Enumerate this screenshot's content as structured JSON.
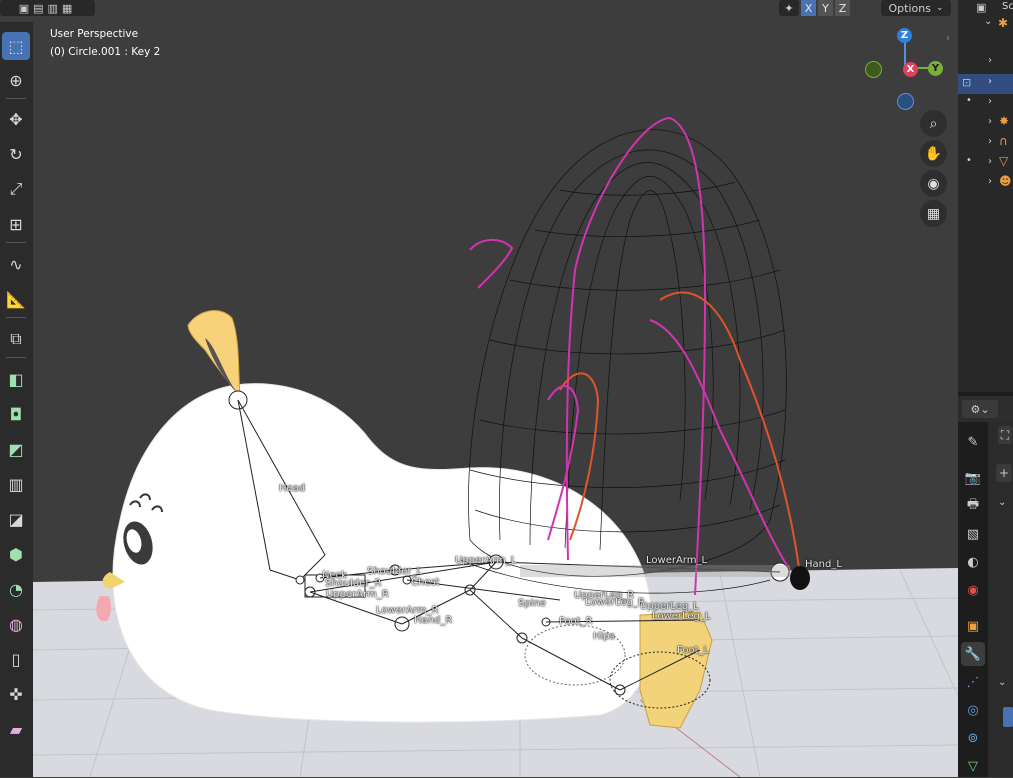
{
  "viewport": {
    "view_name": "User Perspective",
    "object_info": "(0) Circle.001 : Key 2",
    "options_label": "Options",
    "axes": {
      "x": "X",
      "y": "Y",
      "z": "Z"
    },
    "gizmo": {
      "z": "Z",
      "y": "Y",
      "x": "X"
    }
  },
  "bones": {
    "head": "Head",
    "neck": "Neck",
    "shoulder_l": "Shoulder_L",
    "shoulder_r": "Shoulder_R",
    "chest": "Chest",
    "upperarm_l": "UpperArm_L",
    "upperarm_r": "UpperArm_R",
    "lowerarm_l": "LowerArm_L",
    "lowerarm_r": "LowerArm_R",
    "hand_l": "Hand_L",
    "hand_r": "Hand_R",
    "spine": "Spine",
    "upperleg_r": "UpperLeg_R",
    "upperleg_l": "UpperLeg_L",
    "lowerleg_r": "LowerLeg_R",
    "lowerleg_l": "LowerLeg_L",
    "foot_r": "Foot_R",
    "foot_l": "Foot_L",
    "hips": "Hips"
  },
  "right_panel": {
    "scene_label": "Sc"
  },
  "colors": {
    "viewport_bg": "#3d3d3d",
    "floor": "#d8dadf",
    "accent": "#4772b3",
    "selection": "#e05cc3"
  }
}
